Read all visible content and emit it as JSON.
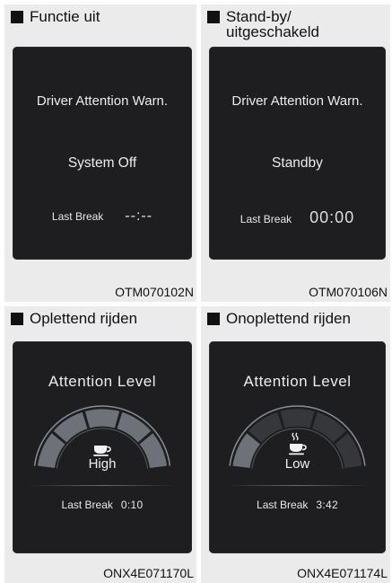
{
  "panels": [
    {
      "caption": "Functie uit",
      "code": "OTM070102N",
      "title": "Driver Attention Warn.",
      "state": "System Off",
      "last_break_label": "Last Break",
      "last_break_value": "--:--"
    },
    {
      "caption": "Stand-by/\nuitgeschakeld",
      "code": "OTM070106N",
      "title": "Driver Attention Warn.",
      "state": "Standby",
      "last_break_label": "Last Break",
      "last_break_value": "00:00"
    },
    {
      "caption": "Oplettend rijden",
      "code": "ONX4E071170L",
      "title": "Attention Level",
      "level": "High",
      "level_fraction": 1.0,
      "icon": "coffee-cup-icon",
      "last_break_label": "Last Break",
      "last_break_value": "0:10"
    },
    {
      "caption": "Onoplettend rijden",
      "code": "ONX4E071174L",
      "title": "Attention Level",
      "level": "Low",
      "level_fraction": 0.2,
      "icon": "hot-coffee-cup-icon",
      "last_break_label": "Last Break",
      "last_break_value": "3:42"
    }
  ],
  "colors": {
    "screen": "#1e1e20",
    "panel": "#ebebeb",
    "text": "#ececec"
  }
}
